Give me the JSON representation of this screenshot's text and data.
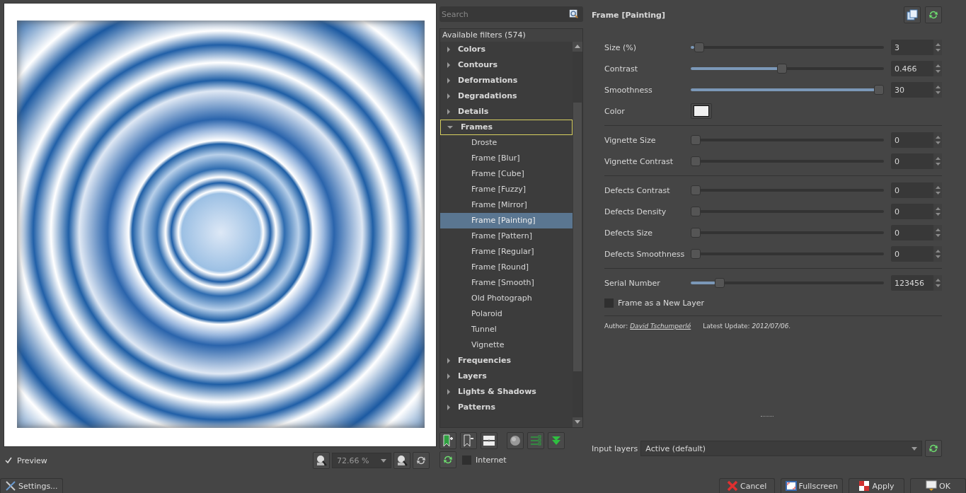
{
  "preview": {
    "checkbox": {
      "label": "Preview",
      "checked": true
    },
    "zoom": "72.66 %"
  },
  "settings_button": "Settings...",
  "search": {
    "placeholder": "Search"
  },
  "filter_tree": {
    "header": "Available filters (574)",
    "items": [
      {
        "label": "Colors",
        "expanded": false,
        "selected": false
      },
      {
        "label": "Contours",
        "expanded": false,
        "selected": false
      },
      {
        "label": "Deformations",
        "expanded": false,
        "selected": false
      },
      {
        "label": "Degradations",
        "expanded": false,
        "selected": false
      },
      {
        "label": "Details",
        "expanded": false,
        "selected": false
      },
      {
        "label": "Frames",
        "expanded": true,
        "selected": false,
        "children": [
          {
            "label": "Droste",
            "selected": false
          },
          {
            "label": "Frame [Blur]",
            "selected": false
          },
          {
            "label": "Frame [Cube]",
            "selected": false
          },
          {
            "label": "Frame [Fuzzy]",
            "selected": false
          },
          {
            "label": "Frame [Mirror]",
            "selected": false
          },
          {
            "label": "Frame [Painting]",
            "selected": true
          },
          {
            "label": "Frame [Pattern]",
            "selected": false
          },
          {
            "label": "Frame [Regular]",
            "selected": false
          },
          {
            "label": "Frame [Round]",
            "selected": false
          },
          {
            "label": "Frame [Smooth]",
            "selected": false
          },
          {
            "label": "Old Photograph",
            "selected": false
          },
          {
            "label": "Polaroid",
            "selected": false
          },
          {
            "label": "Tunnel",
            "selected": false
          },
          {
            "label": "Vignette",
            "selected": false
          }
        ]
      },
      {
        "label": "Frequencies",
        "expanded": false,
        "selected": false
      },
      {
        "label": "Layers",
        "expanded": false,
        "selected": false
      },
      {
        "label": "Lights & Shadows",
        "expanded": false,
        "selected": false
      },
      {
        "label": "Patterns",
        "expanded": false,
        "selected": false
      }
    ]
  },
  "internet": {
    "label": "Internet",
    "checked": false
  },
  "filter": {
    "title": "Frame [Painting]",
    "params": [
      {
        "kind": "slider",
        "label": "Size (%)",
        "level": 0.02,
        "value": "3"
      },
      {
        "kind": "slider",
        "label": "Contrast",
        "level": 0.47,
        "value": "0.466"
      },
      {
        "kind": "slider",
        "label": "Smoothness",
        "level": 1,
        "value": "30"
      },
      {
        "kind": "color",
        "label": "Color",
        "color": "#f0f0f0"
      },
      {
        "kind": "separator"
      },
      {
        "kind": "slider",
        "label": "Vignette Size",
        "level": 0,
        "value": "0"
      },
      {
        "kind": "slider",
        "label": "Vignette Contrast",
        "level": 0,
        "value": "0"
      },
      {
        "kind": "separator"
      },
      {
        "kind": "slider",
        "label": "Defects Contrast",
        "level": 0,
        "value": "0"
      },
      {
        "kind": "slider",
        "label": "Defects Density",
        "level": 0,
        "value": "0"
      },
      {
        "kind": "slider",
        "label": "Defects Size",
        "level": 0,
        "value": "0"
      },
      {
        "kind": "slider",
        "label": "Defects Smoothness",
        "level": 0,
        "value": "0"
      },
      {
        "kind": "separator"
      },
      {
        "kind": "slider",
        "label": "Serial Number",
        "level": 0.13,
        "value": "123456"
      },
      {
        "kind": "checkbox",
        "label": "Frame as a New Layer",
        "checked": false
      },
      {
        "kind": "separator"
      }
    ],
    "author_label": "Author:",
    "author": "David Tschumperlé",
    "update_label": "Latest Update:",
    "update": "2012/07/06."
  },
  "input_layers": {
    "label": "Input layers",
    "value": "Active (default)"
  },
  "buttons": [
    {
      "kind": "cancel",
      "label": "Cancel"
    },
    {
      "kind": "fullscreen",
      "label": "Fullscreen"
    },
    {
      "kind": "apply",
      "label": "Apply"
    },
    {
      "kind": "ok",
      "label": "OK"
    }
  ]
}
